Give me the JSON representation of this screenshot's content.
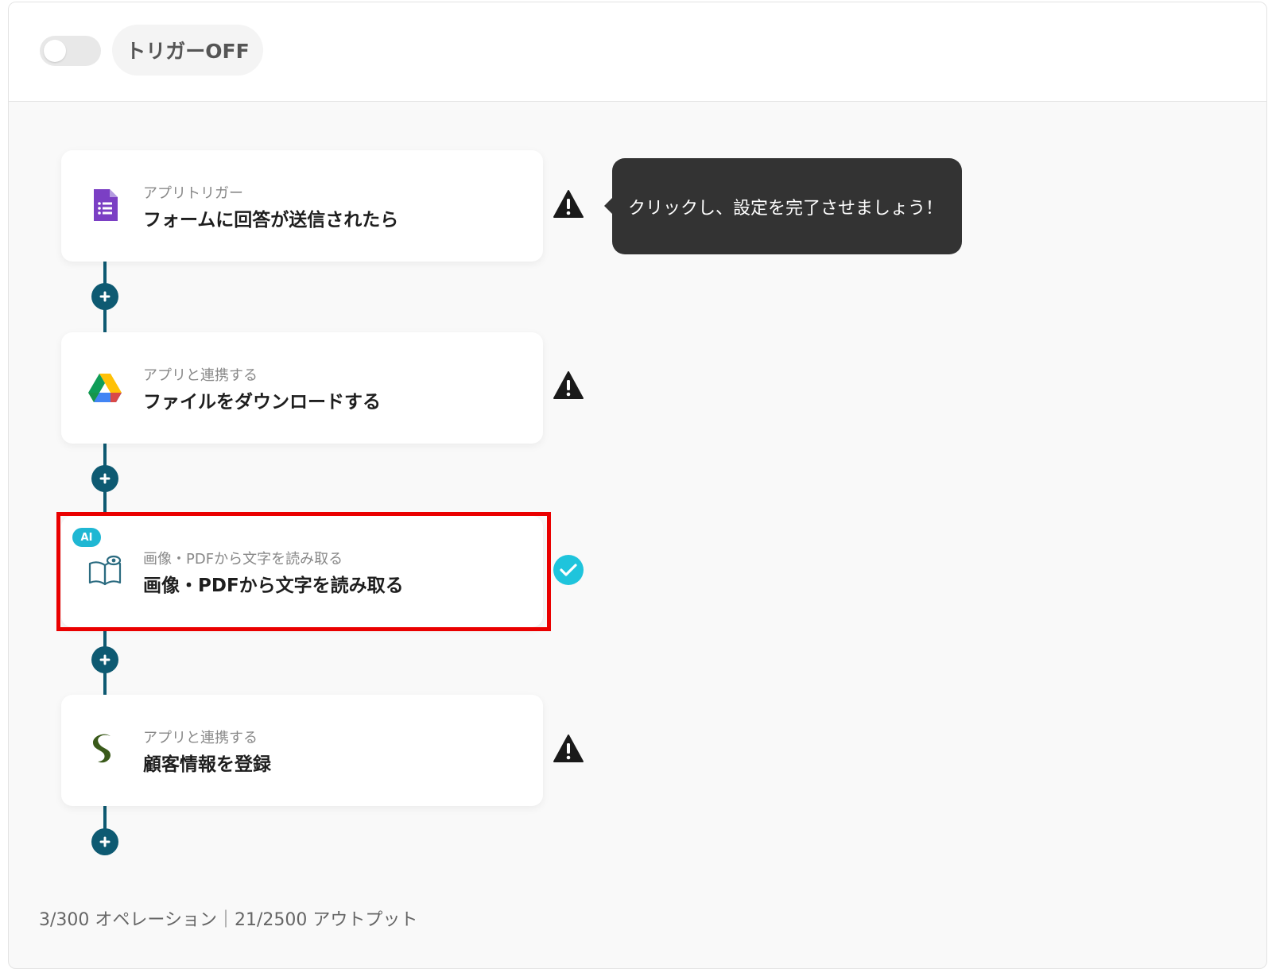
{
  "header": {
    "toggle_state": "off",
    "trigger_label": "トリガーOFF"
  },
  "tooltip": {
    "text": "クリックし、設定を完了させましょう！"
  },
  "steps": [
    {
      "subtitle": "アプリトリガー",
      "title": "フォームに回答が送信されたら",
      "icon": "google-forms-icon",
      "status": "warning"
    },
    {
      "subtitle": "アプリと連携する",
      "title": "ファイルをダウンロードする",
      "icon": "google-drive-icon",
      "status": "warning"
    },
    {
      "badge": "AI",
      "subtitle": "画像・PDFから文字を読み取る",
      "title": "画像・PDFから文字を読み取る",
      "icon": "ocr-book-icon",
      "status": "complete",
      "highlighted": true
    },
    {
      "subtitle": "アプリと連携する",
      "title": "顧客情報を登録",
      "icon": "crm-logo-icon",
      "status": "warning"
    }
  ],
  "footer": {
    "usage_text": "3/300 オペレーション｜21/2500 アウトプット"
  },
  "colors": {
    "connector": "#0e5a72",
    "ai_badge": "#1fb7d3",
    "complete": "#1fc4dc",
    "highlight": "#ea0000",
    "tooltip_bg": "#333333"
  }
}
